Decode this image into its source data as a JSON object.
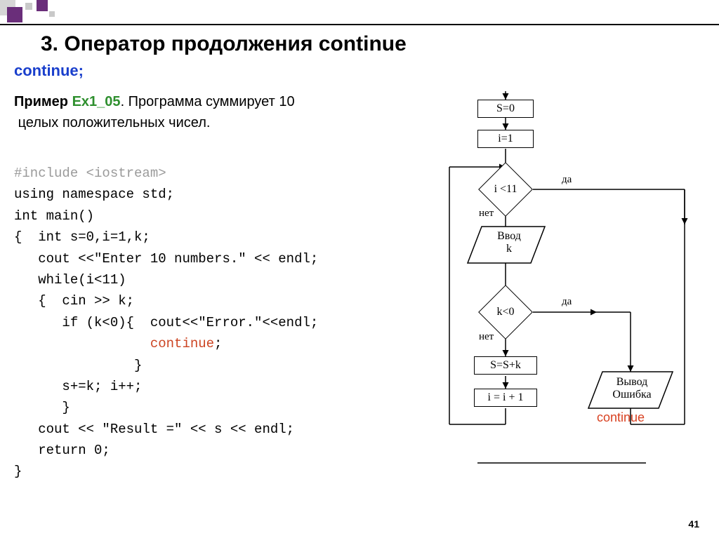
{
  "header": {
    "title": "3. Оператор продолжения continue"
  },
  "subtitle": "continue;",
  "example": {
    "label": "Пример",
    "name": "Ex1_05",
    "desc_line1": ". Программа суммирует 10",
    "desc_line2": "целых положительных чисел."
  },
  "code": {
    "l1": "#include <iostream>",
    "l2": "using namespace std;",
    "l3": "int main()",
    "l4": "{  int s=0,i=1,k;",
    "l5": "   cout <<\"Enter 10 numbers.\" << endl;",
    "l6": "   while(i<11)",
    "l7": "   {  cin >> k;",
    "l8": "      if (k<0){  cout<<\"Error.\"<<endl;",
    "l9_kw": "                 continue",
    "l9_end": ";",
    "l10": "               }",
    "l11": "      s+=k; i++;",
    "l12": "      }",
    "l13": "   cout << \"Result =\" << s << endl;",
    "l14": "   return 0;",
    "l15": "}"
  },
  "flowchart": {
    "b1": "S=0",
    "b2": "i=1",
    "d1": "i <11",
    "p1_l1": "Ввод",
    "p1_l2": "k",
    "d2": "k<0",
    "b3": "S=S+k",
    "b4": "i = i + 1",
    "p2_l1": "Вывод",
    "p2_l2": "Ошибка",
    "yes": "да",
    "no": "нет",
    "continue_label": "continue"
  },
  "page": "41"
}
